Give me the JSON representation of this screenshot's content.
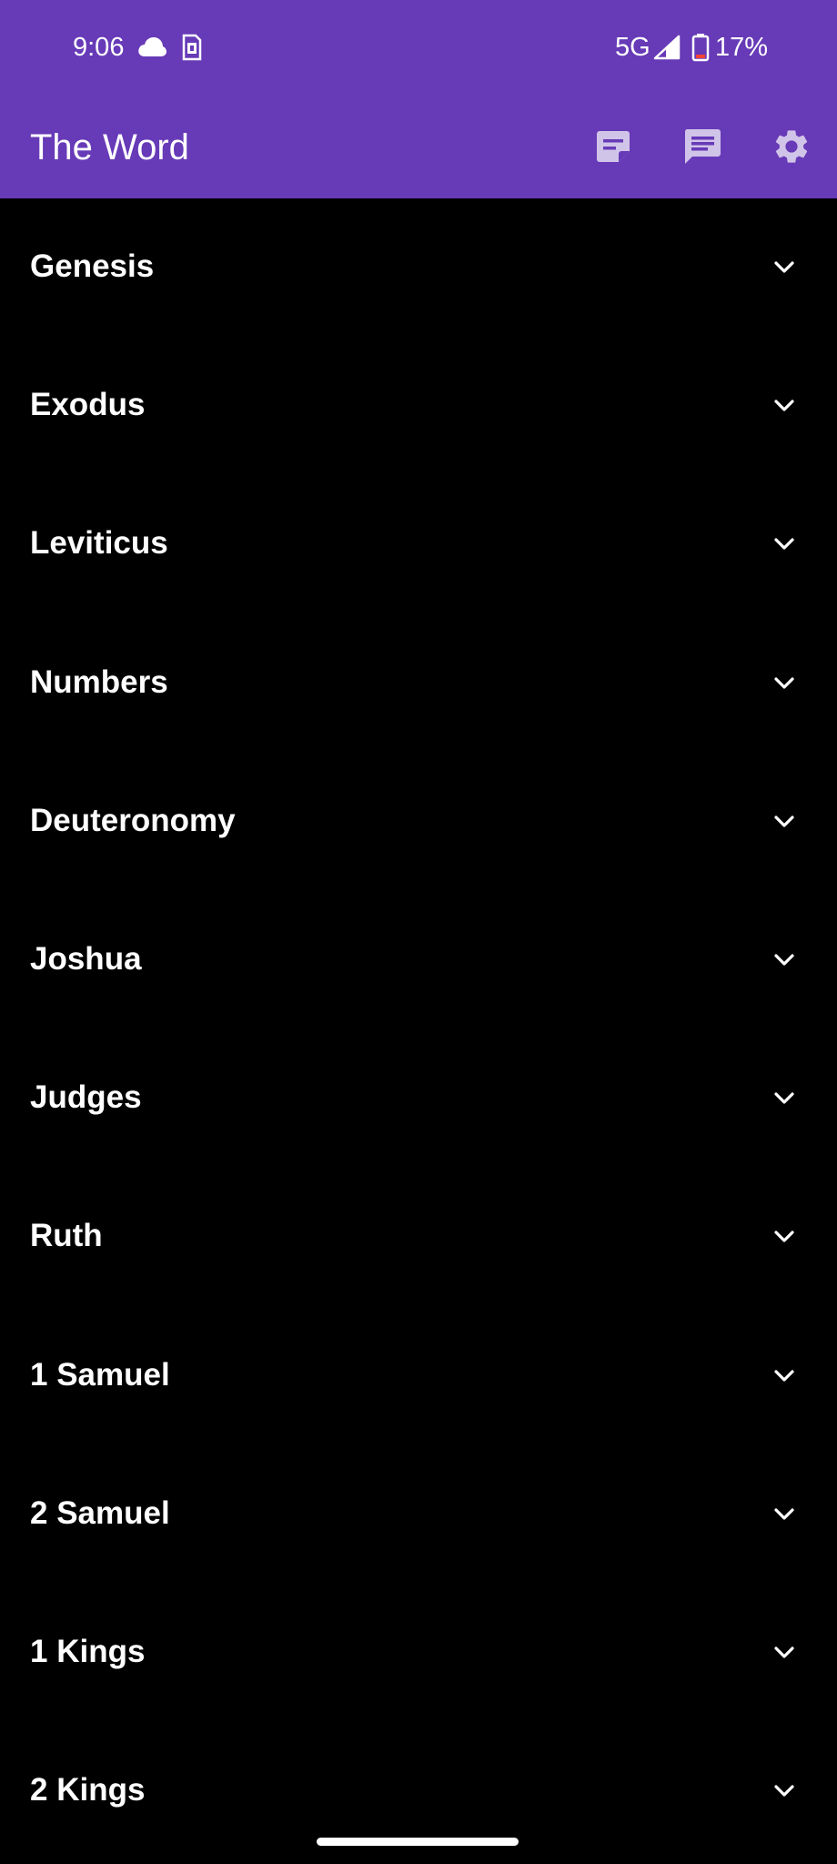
{
  "status_bar": {
    "time": "9:06",
    "network": "5G",
    "battery_percent": "17%",
    "icons": [
      "cloud-icon",
      "sim-card-icon",
      "signal-icon",
      "battery-low-icon"
    ]
  },
  "app_bar": {
    "title": "The Word",
    "actions": [
      {
        "name": "notes-icon"
      },
      {
        "name": "comments-icon"
      },
      {
        "name": "settings-icon"
      }
    ]
  },
  "books": [
    {
      "label": "Genesis"
    },
    {
      "label": "Exodus"
    },
    {
      "label": "Leviticus"
    },
    {
      "label": "Numbers"
    },
    {
      "label": "Deuteronomy"
    },
    {
      "label": "Joshua"
    },
    {
      "label": "Judges"
    },
    {
      "label": "Ruth"
    },
    {
      "label": "1 Samuel"
    },
    {
      "label": "2 Samuel"
    },
    {
      "label": "1 Kings"
    },
    {
      "label": "2 Kings"
    }
  ],
  "colors": {
    "primary": "#673ab7",
    "background": "#000000",
    "icon_tint": "#d1c4e9",
    "text": "#ffffff",
    "battery_warning": "#f44336"
  }
}
